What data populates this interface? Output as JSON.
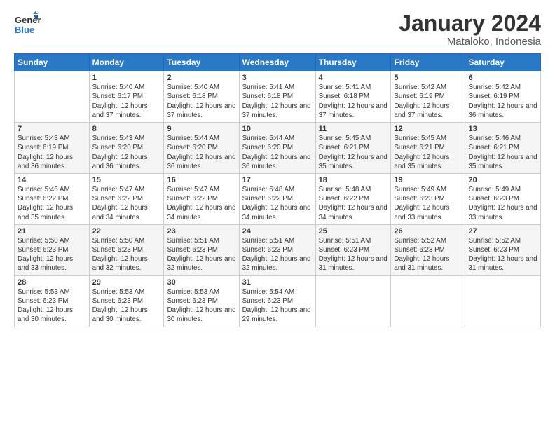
{
  "header": {
    "logo_line1": "General",
    "logo_line2": "Blue",
    "month_year": "January 2024",
    "location": "Mataloko, Indonesia"
  },
  "days_of_week": [
    "Sunday",
    "Monday",
    "Tuesday",
    "Wednesday",
    "Thursday",
    "Friday",
    "Saturday"
  ],
  "weeks": [
    [
      {
        "day": "",
        "sunrise": "",
        "sunset": "",
        "daylight": ""
      },
      {
        "day": "1",
        "sunrise": "Sunrise: 5:40 AM",
        "sunset": "Sunset: 6:17 PM",
        "daylight": "Daylight: 12 hours and 37 minutes."
      },
      {
        "day": "2",
        "sunrise": "Sunrise: 5:40 AM",
        "sunset": "Sunset: 6:18 PM",
        "daylight": "Daylight: 12 hours and 37 minutes."
      },
      {
        "day": "3",
        "sunrise": "Sunrise: 5:41 AM",
        "sunset": "Sunset: 6:18 PM",
        "daylight": "Daylight: 12 hours and 37 minutes."
      },
      {
        "day": "4",
        "sunrise": "Sunrise: 5:41 AM",
        "sunset": "Sunset: 6:18 PM",
        "daylight": "Daylight: 12 hours and 37 minutes."
      },
      {
        "day": "5",
        "sunrise": "Sunrise: 5:42 AM",
        "sunset": "Sunset: 6:19 PM",
        "daylight": "Daylight: 12 hours and 37 minutes."
      },
      {
        "day": "6",
        "sunrise": "Sunrise: 5:42 AM",
        "sunset": "Sunset: 6:19 PM",
        "daylight": "Daylight: 12 hours and 36 minutes."
      }
    ],
    [
      {
        "day": "7",
        "sunrise": "Sunrise: 5:43 AM",
        "sunset": "Sunset: 6:19 PM",
        "daylight": "Daylight: 12 hours and 36 minutes."
      },
      {
        "day": "8",
        "sunrise": "Sunrise: 5:43 AM",
        "sunset": "Sunset: 6:20 PM",
        "daylight": "Daylight: 12 hours and 36 minutes."
      },
      {
        "day": "9",
        "sunrise": "Sunrise: 5:44 AM",
        "sunset": "Sunset: 6:20 PM",
        "daylight": "Daylight: 12 hours and 36 minutes."
      },
      {
        "day": "10",
        "sunrise": "Sunrise: 5:44 AM",
        "sunset": "Sunset: 6:20 PM",
        "daylight": "Daylight: 12 hours and 36 minutes."
      },
      {
        "day": "11",
        "sunrise": "Sunrise: 5:45 AM",
        "sunset": "Sunset: 6:21 PM",
        "daylight": "Daylight: 12 hours and 35 minutes."
      },
      {
        "day": "12",
        "sunrise": "Sunrise: 5:45 AM",
        "sunset": "Sunset: 6:21 PM",
        "daylight": "Daylight: 12 hours and 35 minutes."
      },
      {
        "day": "13",
        "sunrise": "Sunrise: 5:46 AM",
        "sunset": "Sunset: 6:21 PM",
        "daylight": "Daylight: 12 hours and 35 minutes."
      }
    ],
    [
      {
        "day": "14",
        "sunrise": "Sunrise: 5:46 AM",
        "sunset": "Sunset: 6:22 PM",
        "daylight": "Daylight: 12 hours and 35 minutes."
      },
      {
        "day": "15",
        "sunrise": "Sunrise: 5:47 AM",
        "sunset": "Sunset: 6:22 PM",
        "daylight": "Daylight: 12 hours and 34 minutes."
      },
      {
        "day": "16",
        "sunrise": "Sunrise: 5:47 AM",
        "sunset": "Sunset: 6:22 PM",
        "daylight": "Daylight: 12 hours and 34 minutes."
      },
      {
        "day": "17",
        "sunrise": "Sunrise: 5:48 AM",
        "sunset": "Sunset: 6:22 PM",
        "daylight": "Daylight: 12 hours and 34 minutes."
      },
      {
        "day": "18",
        "sunrise": "Sunrise: 5:48 AM",
        "sunset": "Sunset: 6:22 PM",
        "daylight": "Daylight: 12 hours and 34 minutes."
      },
      {
        "day": "19",
        "sunrise": "Sunrise: 5:49 AM",
        "sunset": "Sunset: 6:23 PM",
        "daylight": "Daylight: 12 hours and 33 minutes."
      },
      {
        "day": "20",
        "sunrise": "Sunrise: 5:49 AM",
        "sunset": "Sunset: 6:23 PM",
        "daylight": "Daylight: 12 hours and 33 minutes."
      }
    ],
    [
      {
        "day": "21",
        "sunrise": "Sunrise: 5:50 AM",
        "sunset": "Sunset: 6:23 PM",
        "daylight": "Daylight: 12 hours and 33 minutes."
      },
      {
        "day": "22",
        "sunrise": "Sunrise: 5:50 AM",
        "sunset": "Sunset: 6:23 PM",
        "daylight": "Daylight: 12 hours and 32 minutes."
      },
      {
        "day": "23",
        "sunrise": "Sunrise: 5:51 AM",
        "sunset": "Sunset: 6:23 PM",
        "daylight": "Daylight: 12 hours and 32 minutes."
      },
      {
        "day": "24",
        "sunrise": "Sunrise: 5:51 AM",
        "sunset": "Sunset: 6:23 PM",
        "daylight": "Daylight: 12 hours and 32 minutes."
      },
      {
        "day": "25",
        "sunrise": "Sunrise: 5:51 AM",
        "sunset": "Sunset: 6:23 PM",
        "daylight": "Daylight: 12 hours and 31 minutes."
      },
      {
        "day": "26",
        "sunrise": "Sunrise: 5:52 AM",
        "sunset": "Sunset: 6:23 PM",
        "daylight": "Daylight: 12 hours and 31 minutes."
      },
      {
        "day": "27",
        "sunrise": "Sunrise: 5:52 AM",
        "sunset": "Sunset: 6:23 PM",
        "daylight": "Daylight: 12 hours and 31 minutes."
      }
    ],
    [
      {
        "day": "28",
        "sunrise": "Sunrise: 5:53 AM",
        "sunset": "Sunset: 6:23 PM",
        "daylight": "Daylight: 12 hours and 30 minutes."
      },
      {
        "day": "29",
        "sunrise": "Sunrise: 5:53 AM",
        "sunset": "Sunset: 6:23 PM",
        "daylight": "Daylight: 12 hours and 30 minutes."
      },
      {
        "day": "30",
        "sunrise": "Sunrise: 5:53 AM",
        "sunset": "Sunset: 6:23 PM",
        "daylight": "Daylight: 12 hours and 30 minutes."
      },
      {
        "day": "31",
        "sunrise": "Sunrise: 5:54 AM",
        "sunset": "Sunset: 6:23 PM",
        "daylight": "Daylight: 12 hours and 29 minutes."
      },
      {
        "day": "",
        "sunrise": "",
        "sunset": "",
        "daylight": ""
      },
      {
        "day": "",
        "sunrise": "",
        "sunset": "",
        "daylight": ""
      },
      {
        "day": "",
        "sunrise": "",
        "sunset": "",
        "daylight": ""
      }
    ]
  ]
}
